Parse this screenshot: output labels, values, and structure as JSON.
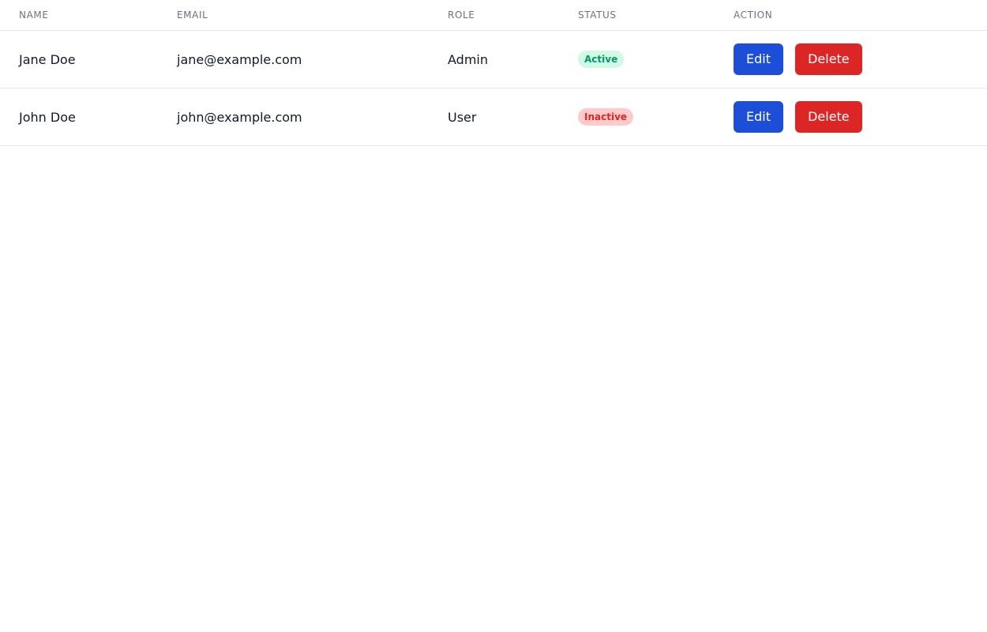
{
  "table": {
    "headers": {
      "name": "Name",
      "email": "Email",
      "role": "Role",
      "status": "Status",
      "action": "Action"
    },
    "rows": [
      {
        "name": "Jane Doe",
        "email": "jane@example.com",
        "role": "Admin",
        "status": "Active",
        "status_type": "active",
        "edit_label": "Edit",
        "delete_label": "Delete"
      },
      {
        "name": "John Doe",
        "email": "john@example.com",
        "role": "User",
        "status": "Inactive",
        "status_type": "inactive",
        "edit_label": "Edit",
        "delete_label": "Delete"
      }
    ]
  },
  "colors": {
    "edit_button": "#1d4ed8",
    "delete_button": "#dc2626",
    "active_bg": "#d1fae5",
    "active_text": "#059669",
    "inactive_bg": "#fecaca",
    "inactive_text": "#dc2626"
  }
}
